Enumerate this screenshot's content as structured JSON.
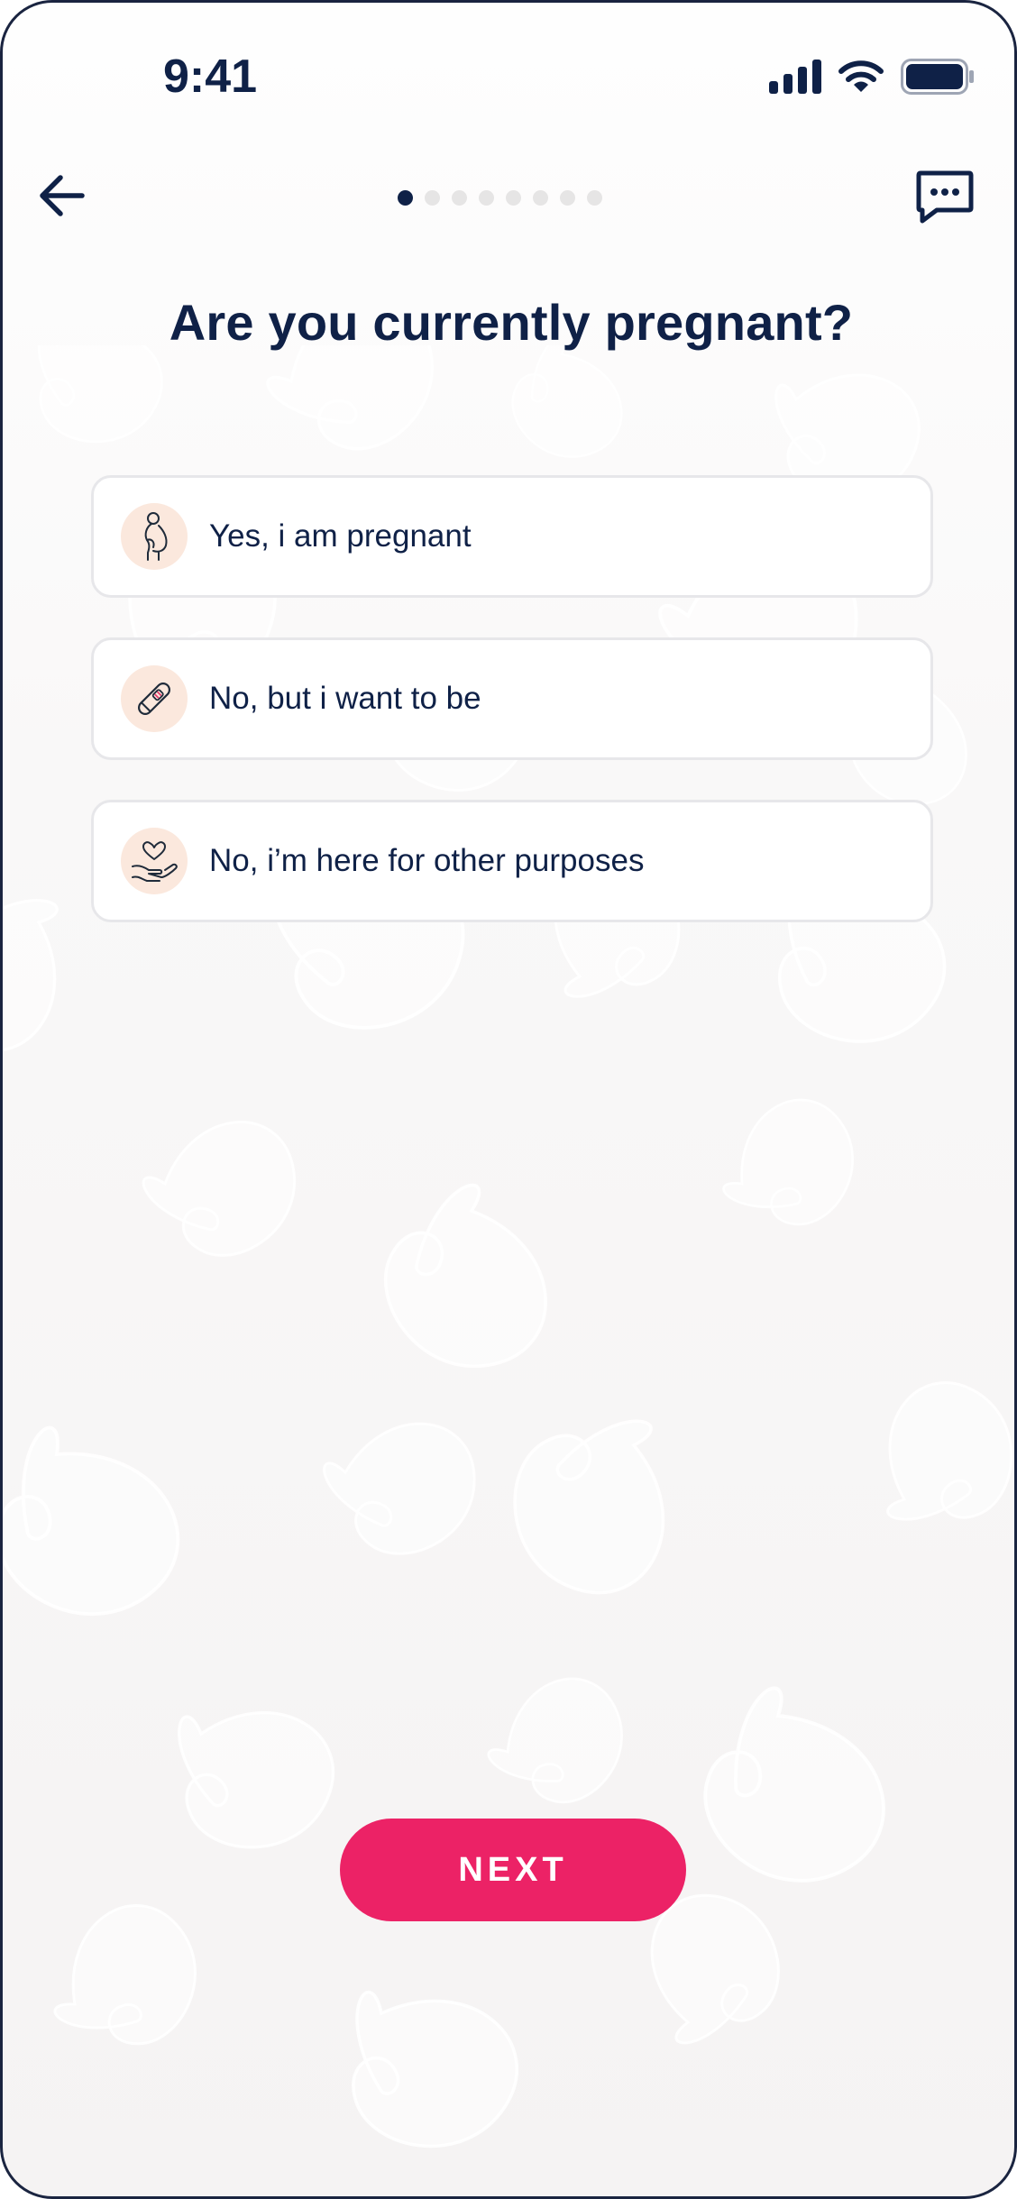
{
  "status_bar": {
    "time": "9:41",
    "signal_icon": "cellular-signal-icon",
    "wifi_icon": "wifi-icon",
    "battery_icon": "battery-icon"
  },
  "header": {
    "back_icon": "arrow-left-icon",
    "chat_icon": "chat-bubble-icon",
    "progress": {
      "total_steps": 8,
      "current_step": 1
    }
  },
  "question": {
    "title": "Are you currently pregnant?"
  },
  "options": [
    {
      "label": "Yes, i am pregnant",
      "icon": "pregnant-woman-icon"
    },
    {
      "label": "No, but i want to be",
      "icon": "pregnancy-test-icon"
    },
    {
      "label": "No, i’m here for other purposes",
      "icon": "heart-in-hand-icon"
    }
  ],
  "footer": {
    "next_label": "NEXT"
  },
  "colors": {
    "primary_text": "#0f2147",
    "accent": "#ec2266",
    "icon_background": "#fbe8dd",
    "dot_inactive": "#e6e5e5"
  }
}
